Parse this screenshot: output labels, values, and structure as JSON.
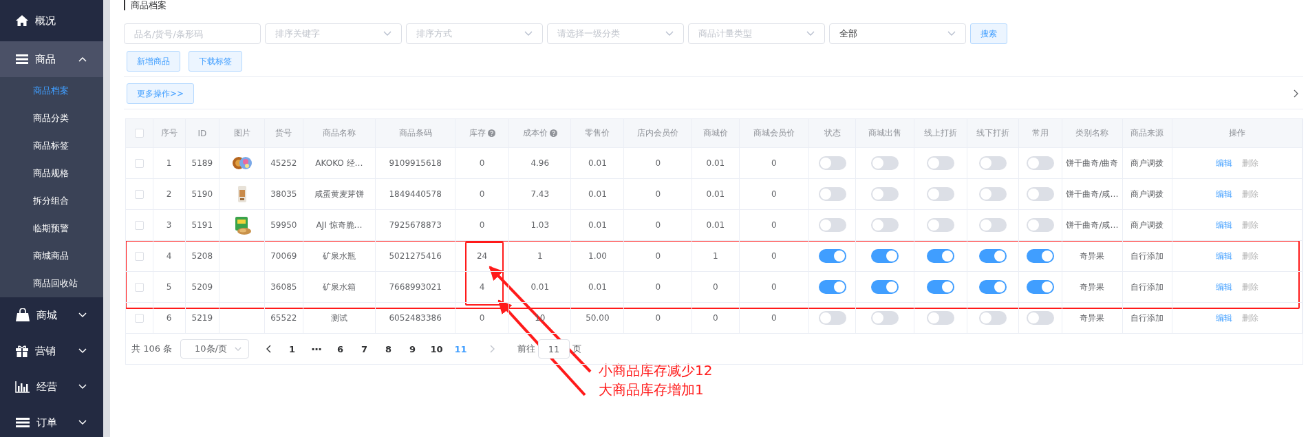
{
  "sidebar": {
    "items": [
      {
        "label": "概况",
        "kind": "home"
      },
      {
        "label": "商品",
        "kind": "menu",
        "expanded": true,
        "children": [
          {
            "label": "商品档案",
            "selected": true
          },
          {
            "label": "商品分类",
            "selected": false
          },
          {
            "label": "商品标签",
            "selected": false
          },
          {
            "label": "商品规格",
            "selected": false
          },
          {
            "label": "拆分组合",
            "selected": false
          },
          {
            "label": "临期预警",
            "selected": false
          },
          {
            "label": "商城商品",
            "selected": false
          },
          {
            "label": "商品回收站",
            "selected": false
          }
        ]
      },
      {
        "label": "商城",
        "kind": "bag",
        "expanded": false
      },
      {
        "label": "营销",
        "kind": "gift",
        "expanded": false
      },
      {
        "label": "经营",
        "kind": "chart",
        "expanded": false
      },
      {
        "label": "订单",
        "kind": "list",
        "expanded": false
      }
    ]
  },
  "page_title": "商品档案",
  "filters": [
    {
      "kind": "input",
      "placeholder": "品名/货号/条形码"
    },
    {
      "kind": "select",
      "placeholder": "排序关键字"
    },
    {
      "kind": "select",
      "placeholder": "排序方式"
    },
    {
      "kind": "select",
      "placeholder": "请选择一级分类"
    },
    {
      "kind": "select",
      "placeholder": "商品计量类型"
    },
    {
      "kind": "select",
      "value": "全部"
    }
  ],
  "search_button": "搜索",
  "action_buttons": [
    "新增商品",
    "下载标签"
  ],
  "more_button": "更多操作>>",
  "table": {
    "columns": [
      {
        "kind": "check",
        "checked": false
      },
      {
        "label": "序号",
        "kind": "text"
      },
      {
        "label": "ID",
        "kind": "text"
      },
      {
        "label": "图片",
        "kind": "picture"
      },
      {
        "label": "货号",
        "kind": "text"
      },
      {
        "label": "商品名称",
        "kind": "text"
      },
      {
        "label": "商品条码",
        "kind": "text"
      },
      {
        "label": "库存",
        "kind": "text",
        "help": true
      },
      {
        "label": "成本价",
        "kind": "text",
        "help": true
      },
      {
        "label": "零售价",
        "kind": "text"
      },
      {
        "label": "店内会员价",
        "kind": "text"
      },
      {
        "label": "商城价",
        "kind": "text"
      },
      {
        "label": "商城会员价",
        "kind": "text"
      },
      {
        "label": "状态",
        "kind": "switch"
      },
      {
        "label": "商城出售",
        "kind": "switch"
      },
      {
        "label": "线上打折",
        "kind": "switch"
      },
      {
        "label": "线下打折",
        "kind": "switch"
      },
      {
        "label": "常用",
        "kind": "switch"
      },
      {
        "label": "类别名称",
        "kind": "text"
      },
      {
        "label": "商品来源",
        "kind": "text"
      },
      {
        "label": "操作",
        "kind": "actions"
      }
    ],
    "rows": [
      {
        "cells": [
          {
            "checked": false
          },
          {
            "text": "1"
          },
          {
            "text": "5189"
          },
          {
            "picture": true
          },
          {
            "text": "45252"
          },
          {
            "text": "AKOKO 经…"
          },
          {
            "text": "9109915618"
          },
          {
            "text": "0"
          },
          {
            "text": "4.96"
          },
          {
            "text": "0.01"
          },
          {
            "text": "0"
          },
          {
            "text": "0.01"
          },
          {
            "text": "0"
          },
          {
            "on": false
          },
          {
            "on": false
          },
          {
            "on": false
          },
          {
            "on": false
          },
          {
            "on": false
          },
          {
            "text": "饼干曲奇/曲奇"
          },
          {
            "text": "商户调拨"
          },
          {
            "actions": [
              "编辑",
              "删除"
            ]
          }
        ]
      },
      {
        "cells": [
          {
            "checked": false
          },
          {
            "text": "2"
          },
          {
            "text": "5190"
          },
          {
            "picture": true
          },
          {
            "text": "38035"
          },
          {
            "text": "咸蛋黄麦芽饼"
          },
          {
            "text": "1849440578"
          },
          {
            "text": "0"
          },
          {
            "text": "7.43"
          },
          {
            "text": "0.01"
          },
          {
            "text": "0"
          },
          {
            "text": "0.01"
          },
          {
            "text": "0"
          },
          {
            "on": false
          },
          {
            "on": false
          },
          {
            "on": false
          },
          {
            "on": false
          },
          {
            "on": false
          },
          {
            "text": "饼干曲奇/咸…"
          },
          {
            "text": "商户调拨"
          },
          {
            "actions": [
              "编辑",
              "删除"
            ]
          }
        ]
      },
      {
        "cells": [
          {
            "checked": false
          },
          {
            "text": "3"
          },
          {
            "text": "5191"
          },
          {
            "picture": true
          },
          {
            "text": "59950"
          },
          {
            "text": "AJI 惊奇脆…"
          },
          {
            "text": "7925678873"
          },
          {
            "text": "0"
          },
          {
            "text": "1.03"
          },
          {
            "text": "0.01"
          },
          {
            "text": "0"
          },
          {
            "text": "0.01"
          },
          {
            "text": "0"
          },
          {
            "on": false
          },
          {
            "on": false
          },
          {
            "on": false
          },
          {
            "on": false
          },
          {
            "on": false
          },
          {
            "text": "饼干曲奇/咸…"
          },
          {
            "text": "商户调拨"
          },
          {
            "actions": [
              "编辑",
              "删除"
            ]
          }
        ]
      },
      {
        "cells": [
          {
            "checked": false
          },
          {
            "text": "4"
          },
          {
            "text": "5208"
          },
          {
            "picture": false
          },
          {
            "text": "70069"
          },
          {
            "text": "矿泉水瓶"
          },
          {
            "text": "5021275416"
          },
          {
            "text": "24"
          },
          {
            "text": "1"
          },
          {
            "text": "1.00"
          },
          {
            "text": "0"
          },
          {
            "text": "1"
          },
          {
            "text": "0"
          },
          {
            "on": true
          },
          {
            "on": true
          },
          {
            "on": true
          },
          {
            "on": true
          },
          {
            "on": true
          },
          {
            "text": "奇异果"
          },
          {
            "text": "自行添加"
          },
          {
            "actions": [
              "编辑",
              "删除"
            ]
          }
        ]
      },
      {
        "cells": [
          {
            "checked": false
          },
          {
            "text": "5"
          },
          {
            "text": "5209"
          },
          {
            "picture": false
          },
          {
            "text": "36085"
          },
          {
            "text": "矿泉水箱"
          },
          {
            "text": "7668993021"
          },
          {
            "text": "4"
          },
          {
            "text": "0.01"
          },
          {
            "text": "0.01"
          },
          {
            "text": "0"
          },
          {
            "text": "0"
          },
          {
            "text": "0"
          },
          {
            "on": true
          },
          {
            "on": true
          },
          {
            "on": true
          },
          {
            "on": true
          },
          {
            "on": true
          },
          {
            "text": "奇异果"
          },
          {
            "text": "自行添加"
          },
          {
            "actions": [
              "编辑",
              "删除"
            ]
          }
        ]
      },
      {
        "cells": [
          {
            "checked": false
          },
          {
            "text": "6"
          },
          {
            "text": "5219"
          },
          {
            "picture": false
          },
          {
            "text": "65522"
          },
          {
            "text": "测试"
          },
          {
            "text": "6052483386"
          },
          {
            "text": "0"
          },
          {
            "text": "10"
          },
          {
            "text": "50.00"
          },
          {
            "text": "0"
          },
          {
            "text": "0"
          },
          {
            "text": "0"
          },
          {
            "on": false
          },
          {
            "on": false
          },
          {
            "on": false
          },
          {
            "on": false
          },
          {
            "on": false
          },
          {
            "text": "奇异果"
          },
          {
            "text": "自行添加"
          },
          {
            "actions": [
              "编辑",
              "删除"
            ]
          }
        ]
      }
    ]
  },
  "pagination": {
    "total": "共 106 条",
    "page_size": "10条/页",
    "pages": [
      {
        "label": "1",
        "kind": "page",
        "selected": false
      },
      {
        "label": "···",
        "kind": "more",
        "selected": false
      },
      {
        "label": "6",
        "kind": "page",
        "selected": false
      },
      {
        "label": "7",
        "kind": "page",
        "selected": false
      },
      {
        "label": "8",
        "kind": "page",
        "selected": false
      },
      {
        "label": "9",
        "kind": "page",
        "selected": false
      },
      {
        "label": "10",
        "kind": "page",
        "selected": false
      },
      {
        "label": "11",
        "kind": "page",
        "selected": true
      }
    ],
    "goto_label": "前往",
    "goto_value": "11",
    "goto_suffix": "页"
  },
  "annotations": {
    "highlight": true,
    "callouts": [
      "小商品库存减少12",
      "大商品库存增加1"
    ]
  }
}
